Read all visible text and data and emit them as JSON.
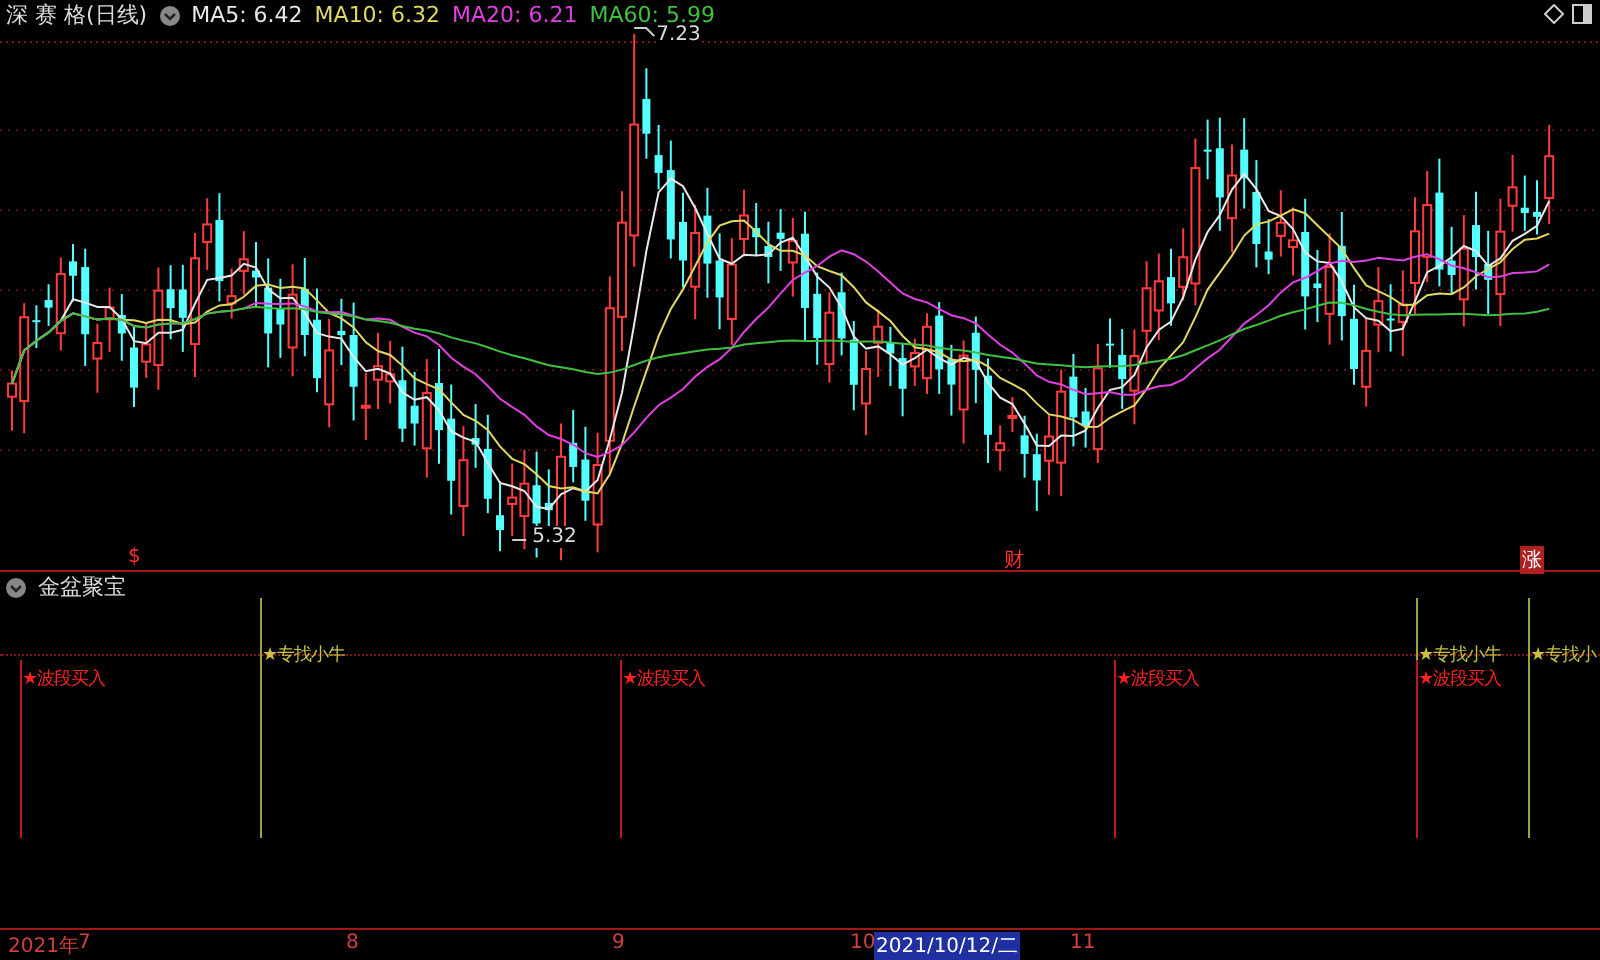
{
  "main_panel": {
    "title": "深 赛 格(日线)",
    "indicators": [
      {
        "label": "MA5: 6.42",
        "color": "#e8e8e8"
      },
      {
        "label": "MA10: 6.32",
        "color": "#e0d860"
      },
      {
        "label": "MA20: 6.21",
        "color": "#e040e0"
      },
      {
        "label": "MA60: 5.99",
        "color": "#40c040"
      }
    ],
    "high_label": "7.23",
    "low_label": "5.32",
    "markers": [
      {
        "kind": "plain",
        "text": "$"
      },
      {
        "kind": "plain",
        "text": "财"
      },
      {
        "kind": "badge",
        "text": "涨"
      }
    ]
  },
  "indicator_panel": {
    "title": "金盆聚宝",
    "signals": [
      {
        "kind": "buy",
        "text": "★波段买入"
      },
      {
        "kind": "bull",
        "text": "★专找小牛"
      },
      {
        "kind": "buy",
        "text": "★波段买入"
      },
      {
        "kind": "buy",
        "text": "★波段买入"
      },
      {
        "kind": "bull",
        "text": "★专找小牛"
      },
      {
        "kind": "buy",
        "text": "★波段买入"
      },
      {
        "kind": "bull",
        "text": "★专找小"
      }
    ]
  },
  "time_axis": {
    "labels": [
      {
        "text": "2021年",
        "selected": false
      },
      {
        "text": "7",
        "selected": false
      },
      {
        "text": "8",
        "selected": false
      },
      {
        "text": "9",
        "selected": false
      },
      {
        "text": "10",
        "selected": false
      },
      {
        "text": "2021/10/12/二",
        "selected": true
      },
      {
        "text": "11",
        "selected": false
      }
    ]
  }
}
